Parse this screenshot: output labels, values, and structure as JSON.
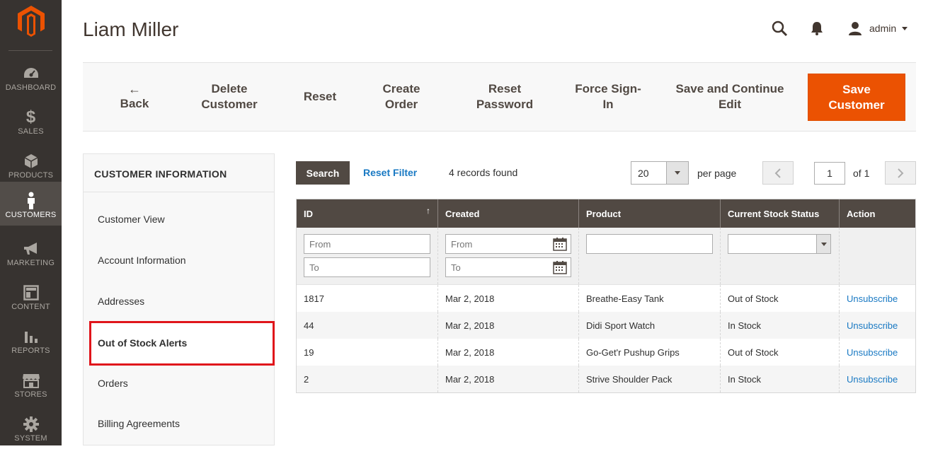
{
  "sidebar": {
    "logo": "magento-logo",
    "items": [
      {
        "label": "DASHBOARD",
        "icon": "dashboard-icon"
      },
      {
        "label": "SALES",
        "icon": "dollar-icon"
      },
      {
        "label": "PRODUCTS",
        "icon": "cube-icon"
      },
      {
        "label": "CUSTOMERS",
        "icon": "person-icon",
        "active": true
      },
      {
        "label": "MARKETING",
        "icon": "megaphone-icon"
      },
      {
        "label": "CONTENT",
        "icon": "layout-icon"
      },
      {
        "label": "REPORTS",
        "icon": "bar-chart-icon"
      },
      {
        "label": "STORES",
        "icon": "store-icon"
      },
      {
        "label": "SYSTEM",
        "icon": "gear-icon"
      }
    ]
  },
  "header": {
    "title": "Liam Miller",
    "user": "admin"
  },
  "toolbar": {
    "back": "Back",
    "back_arrow": "←",
    "delete_1": "Delete",
    "delete_2": "Customer",
    "reset": "Reset",
    "create_1": "Create",
    "create_2": "Order",
    "reset_pw_1": "Reset",
    "reset_pw_2": "Password",
    "force_1": "Force Sign-",
    "force_2": "In",
    "save_continue_1": "Save and Continue",
    "save_continue_2": "Edit",
    "save_1": "Save",
    "save_2": "Customer"
  },
  "tabs": {
    "title": "CUSTOMER INFORMATION",
    "items": [
      "Customer View",
      "Account Information",
      "Addresses",
      "Out of Stock Alerts",
      "Orders",
      "Billing Agreements"
    ],
    "active_index": 3
  },
  "grid": {
    "search_label": "Search",
    "reset_filter": "Reset Filter",
    "records_found": "4 records found",
    "per_page_value": "20",
    "per_page_label": "per page",
    "page_value": "1",
    "page_of": "of 1",
    "columns": [
      "ID",
      "Created",
      "Product",
      "Current Stock Status",
      "Action"
    ],
    "sort_indicator": "↑",
    "filters": {
      "id_from": "From",
      "id_to": "To",
      "created_from": "From",
      "created_to": "To"
    },
    "rows": [
      {
        "id": "1817",
        "created": "Mar 2, 2018",
        "product": "Breathe-Easy Tank",
        "status": "Out of Stock",
        "action": "Unsubscribe"
      },
      {
        "id": "44",
        "created": "Mar 2, 2018",
        "product": "Didi Sport Watch",
        "status": "In Stock",
        "action": "Unsubscribe"
      },
      {
        "id": "19",
        "created": "Mar 2, 2018",
        "product": "Go-Get'r Pushup Grips",
        "status": "Out of Stock",
        "action": "Unsubscribe"
      },
      {
        "id": "2",
        "created": "Mar 2, 2018",
        "product": "Strive Shoulder Pack",
        "status": "In Stock",
        "action": "Unsubscribe"
      }
    ]
  },
  "colors": {
    "sidebar_bg": "#373330",
    "accent_orange": "#eb5202",
    "grid_header": "#514943",
    "link_blue": "#1979c3",
    "highlight_red": "#e0151b"
  }
}
